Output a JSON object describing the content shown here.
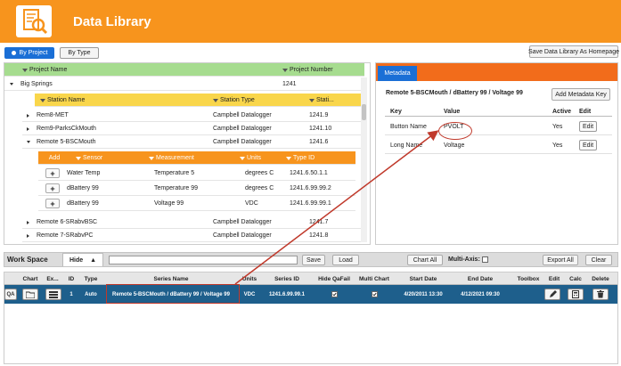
{
  "header": {
    "title": "Data Library"
  },
  "tabs": {
    "by_project": "By Project",
    "by_type": "By Type",
    "save_homepage": "Save Data Library As Homepage"
  },
  "project_table": {
    "columns": [
      "Project Name",
      "Project Number"
    ],
    "project": {
      "name": "Big Springs",
      "number": "1241"
    },
    "station_columns": [
      "Station Name",
      "Station Type",
      "Stati..."
    ],
    "stations": [
      {
        "name": "Rem8-MET",
        "type": "Campbell Datalogger",
        "id": "1241.9",
        "expanded": false
      },
      {
        "name": "Rem9-ParksCkMouth",
        "type": "Campbell Datalogger",
        "id": "1241.10",
        "expanded": false
      },
      {
        "name": "Remote 5-BSCMouth",
        "type": "Campbell Datalogger",
        "id": "1241.6",
        "expanded": true
      },
      {
        "name": "Remote 6-SRabvBSC",
        "type": "Campbell Datalogger",
        "id": "1241.7",
        "expanded": false
      },
      {
        "name": "Remote 7-SRabvPC",
        "type": "Campbell Datalogger",
        "id": "1241.8",
        "expanded": false
      }
    ],
    "sensor_columns": [
      "Add",
      "Sensor",
      "Measurement",
      "Units",
      "Type ID"
    ],
    "sensors": [
      {
        "sensor": "Water Temp",
        "measurement": "Temperature 5",
        "units": "degrees C",
        "type_id": "1241.6.50.1.1"
      },
      {
        "sensor": "dBattery 99",
        "measurement": "Temperature 99",
        "units": "degrees C",
        "type_id": "1241.6.99.99.2"
      },
      {
        "sensor": "dBattery 99",
        "measurement": "Voltage 99",
        "units": "VDC",
        "type_id": "1241.6.99.99.1"
      }
    ]
  },
  "metadata": {
    "tab": "Metadata",
    "title": "Remote 5-BSCMouth / dBattery 99 / Voltage 99",
    "add_button": "Add Metadata Key",
    "columns": [
      "Key",
      "Value",
      "Active",
      "Edit"
    ],
    "rows": [
      {
        "key": "Button Name",
        "value": "PVOLT",
        "active": "Yes",
        "edit": "Edit"
      },
      {
        "key": "Long Name",
        "value": "Voltage",
        "active": "Yes",
        "edit": "Edit"
      }
    ]
  },
  "workspace": {
    "title": "Work Space",
    "hide": "Hide",
    "save": "Save",
    "load": "Load",
    "chart_all": "Chart All",
    "multi_axis": "Multi-Axis:",
    "export_all": "Export All",
    "clear": "Clear",
    "columns": [
      "Chart",
      "Ex...",
      "ID",
      "Type",
      "Series Name",
      "Units",
      "Series ID",
      "Hide QaFail",
      "Multi Chart",
      "Start Date",
      "End Date",
      "Toolbox",
      "Edit",
      "Calc",
      "Delete"
    ],
    "row": {
      "qa": "QA",
      "id": "1",
      "type": "Auto",
      "series_name": "Remote 5-BSCMouth / dBattery 99 / Voltage 99",
      "units": "VDC",
      "series_id": "1241.6.99.99.1",
      "start_date": "4/20/2011 13:30",
      "end_date": "4/12/2021 09:30"
    }
  },
  "colors": {
    "accent": "#f7941d",
    "primary_blue": "#1a6fd6",
    "row_selected": "#1e5f8c",
    "callout": "#c0392b"
  }
}
